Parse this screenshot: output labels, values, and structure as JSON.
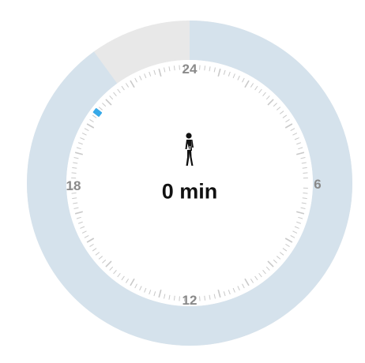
{
  "dial": {
    "hour_labels": {
      "top": "24",
      "right": "6",
      "bottom": "12",
      "left": "18"
    },
    "progress_fraction": 0.9
  },
  "summary": {
    "value_text": "0 min",
    "icon": "walking-person-icon"
  },
  "colors": {
    "ring_progress": "#d5e2ec",
    "ring_remaining": "#e8e8e8",
    "tick": "#c9c9c9",
    "marker": "#37a9e8"
  }
}
